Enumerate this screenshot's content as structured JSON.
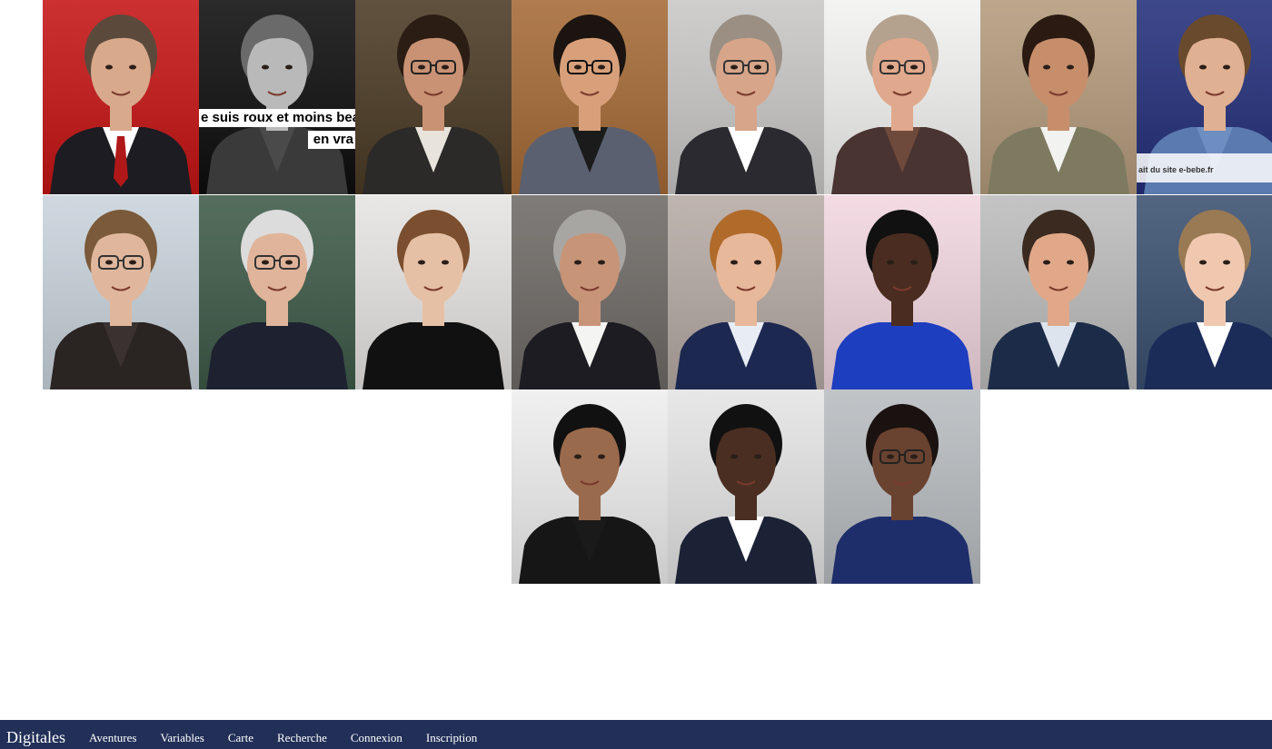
{
  "gallery": {
    "rows": [
      [
        {
          "name": "portrait-1",
          "bg": "#c51414",
          "skin": "#d9a98c",
          "hair": "#5b4a3c",
          "shirt": "#ffffff",
          "jacket": "#1c1c22",
          "tie": "#b01818"
        },
        {
          "name": "portrait-2",
          "bg": "#0d0d0d",
          "skin": "#b9b9b9",
          "hair": "#6a6a6a",
          "shirt": "#4a4a4a",
          "jacket": "#3a3a3a",
          "caption1": "e suis roux et moins bea",
          "caption2": "en vra"
        },
        {
          "name": "portrait-3",
          "bg": "#4a3a24",
          "skin": "#c99274",
          "hair": "#2b1d14",
          "shirt": "#e8e4dc",
          "jacket": "#2c2a28",
          "glasses": "#222222"
        },
        {
          "name": "portrait-4",
          "bg": "#a56a36",
          "skin": "#d8a07a",
          "hair": "#1c1410",
          "shirt": "#1b1b1b",
          "jacket": "#5a6070",
          "glasses": "#111111"
        },
        {
          "name": "portrait-5",
          "bg": "#c8c7c6",
          "skin": "#d7a58a",
          "hair": "#9b8f83",
          "shirt": "#ffffff",
          "jacket": "#2a2a30",
          "glasses": "#333333"
        },
        {
          "name": "portrait-6",
          "bg": "#f2f2f0",
          "skin": "#e0a88c",
          "hair": "#b5a28e",
          "shirt": "#6e4a3c",
          "jacket": "#4a3432",
          "glasses": "#333333"
        },
        {
          "name": "portrait-7",
          "bg": "#b49b7c",
          "skin": "#c78e6c",
          "hair": "#2a1a12",
          "shirt": "#f2f2f0",
          "jacket": "#7d7a60"
        },
        {
          "name": "portrait-8",
          "bg": "#232f7a",
          "skin": "#e0b092",
          "hair": "#6a4a2c",
          "shirt": "#6e8ec2",
          "jacket": "#5a7ab0",
          "caption3": "ait du site  e-bebe.fr"
        }
      ],
      [
        {
          "name": "portrait-9",
          "bg": "#c9d3dc",
          "skin": "#e0b79c",
          "hair": "#7a5a3a",
          "shirt": "#3a3230",
          "jacket": "#2a2422",
          "glasses": "#333333"
        },
        {
          "name": "portrait-10",
          "bg": "#3d5a48",
          "skin": "#e0b49a",
          "hair": "#dcdcdc",
          "shirt": "#1e2230",
          "jacket": "#1e2230",
          "glasses": "#333333"
        },
        {
          "name": "portrait-11",
          "bg": "#e6e4e2",
          "skin": "#e6c0a4",
          "hair": "#7a4e2e",
          "shirt": "#111111",
          "jacket": "#111111"
        },
        {
          "name": "portrait-12",
          "bg": "#6e6a66",
          "skin": "#c89478",
          "hair": "#a8a6a2",
          "shirt": "#f4f4f2",
          "jacket": "#1c1c22"
        },
        {
          "name": "portrait-13",
          "bg": "#b6aaa4",
          "skin": "#e8b89a",
          "hair": "#b06a2a",
          "shirt": "#e8ecf4",
          "jacket": "#1c2850"
        },
        {
          "name": "portrait-14",
          "bg": "#f2d6e0",
          "skin": "#4a2c20",
          "hair": "#111111",
          "shirt": "#1e3ec0",
          "jacket": "#1e3ec0"
        },
        {
          "name": "portrait-15",
          "bg": "#bcbcbc",
          "skin": "#e0a888",
          "hair": "#3a2a20",
          "shirt": "#dde4ee",
          "jacket": "#1c2c48"
        },
        {
          "name": "portrait-16",
          "bg": "#3a5070",
          "skin": "#f0c8b0",
          "hair": "#9a7a54",
          "shirt": "#ffffff",
          "jacket": "#1c2c58"
        }
      ],
      [
        {
          "name": "portrait-17",
          "bg": "#eeeeee",
          "skin": "#9a6a4c",
          "hair": "#111111",
          "shirt": "#1a1a1a",
          "jacket": "#161616"
        },
        {
          "name": "portrait-18",
          "bg": "#e4e4e4",
          "skin": "#4a2e22",
          "hair": "#111111",
          "shirt": "#ffffff",
          "jacket": "#1c2236"
        },
        {
          "name": "portrait-19",
          "bg": "#b8bcc0",
          "skin": "#6a4230",
          "hair": "#1a1210",
          "shirt": "#1e2e6a",
          "jacket": "#1e2e6a",
          "glasses": "#222222"
        }
      ]
    ]
  },
  "navbar": {
    "brand": "Digitales",
    "items": [
      "Aventures",
      "Variables",
      "Carte",
      "Recherche",
      "Connexion",
      "Inscription"
    ]
  }
}
